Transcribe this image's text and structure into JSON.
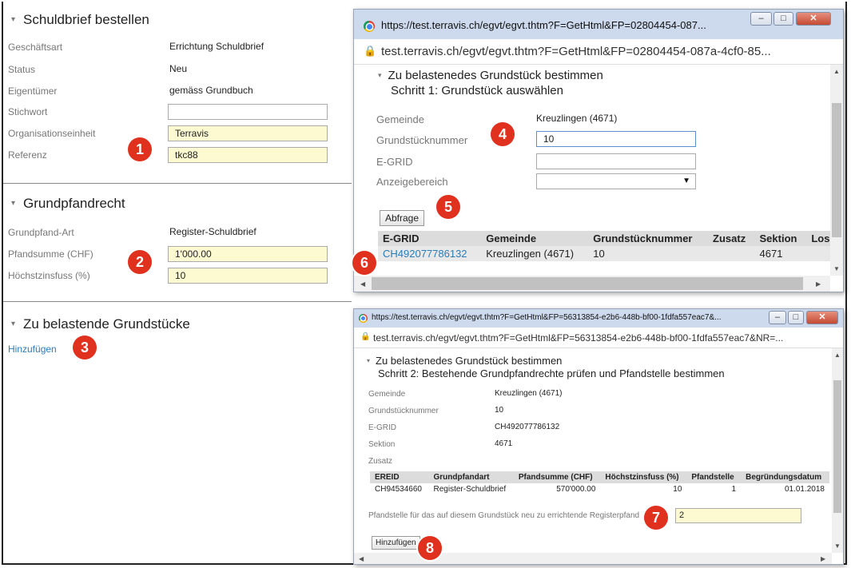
{
  "form": {
    "section1_title": "Schuldbrief bestellen",
    "fields1": [
      {
        "label": "Geschäftsart",
        "value": "Errichtung Schuldbrief"
      },
      {
        "label": "Status",
        "value": "Neu"
      },
      {
        "label": "Eigentümer",
        "value": "gemäss Grundbuch"
      }
    ],
    "stichwort_label": "Stichwort",
    "stichwort_value": "",
    "org_label": "Organisationseinheit",
    "org_value": "Terravis",
    "ref_label": "Referenz",
    "ref_value": "tkc88",
    "section2_title": "Grundpfandrecht",
    "art_label": "Grundpfand-Art",
    "art_value": "Register-Schuldbrief",
    "pfand_label": "Pfandsumme (CHF)",
    "pfand_value": "1'000.00",
    "zins_label": "Höchstzinsfuss (%)",
    "zins_value": "10",
    "section3_title": "Zu belastende Grundstücke",
    "add_link": "Hinzufügen"
  },
  "badges": [
    "1",
    "2",
    "3",
    "4",
    "5",
    "6",
    "7",
    "8"
  ],
  "window1": {
    "title": "https://test.terravis.ch/egvt/egvt.thtm?F=GetHtml&FP=02804454-087...",
    "url": "test.terravis.ch/egvt/egvt.thtm?F=GetHtml&FP=02804454-087a-4cf0-85...",
    "heading": "Zu belastenedes Grundstück bestimmen",
    "step": "Schritt 1: Grundstück auswählen",
    "gemeinde_label": "Gemeinde",
    "gemeinde_value": "Kreuzlingen (4671)",
    "nummer_label": "Grundstücknummer",
    "nummer_value": "10",
    "egrid_label": "E-GRID",
    "egrid_value": "",
    "anzeige_label": "Anzeigebereich",
    "anzeige_value": "",
    "query_button": "Abfrage",
    "table": {
      "headers": [
        "E-GRID",
        "Gemeinde",
        "Grundstücknummer",
        "Zusatz",
        "Sektion",
        "Los"
      ],
      "rows": [
        [
          "CH492077786132",
          "Kreuzlingen (4671)",
          "10",
          "",
          "4671",
          ""
        ]
      ]
    }
  },
  "window2": {
    "title": "https://test.terravis.ch/egvt/egvt.thtm?F=GetHtml&FP=56313854-e2b6-448b-bf00-1fdfa557eac7&...",
    "url": "test.terravis.ch/egvt/egvt.thtm?F=GetHtml&FP=56313854-e2b6-448b-bf00-1fdfa557eac7&NR=...",
    "heading": "Zu belastenedes Grundstück bestimmen",
    "step": "Schritt 2: Bestehende Grundpfandrechte prüfen und Pfandstelle bestimmen",
    "details": [
      {
        "label": "Gemeinde",
        "value": "Kreuzlingen (4671)"
      },
      {
        "label": "Grundstücknummer",
        "value": "10"
      },
      {
        "label": "E-GRID",
        "value": "CH492077786132"
      },
      {
        "label": "Sektion",
        "value": "4671"
      },
      {
        "label": "Zusatz",
        "value": ""
      }
    ],
    "table": {
      "headers": [
        "EREID",
        "Grundpfandart",
        "Pfandsumme (CHF)",
        "Höchstzinsfuss (%)",
        "Pfandstelle",
        "Begründungsdatum"
      ],
      "rows": [
        [
          "CH94534660",
          "Register-Schuldbrief",
          "570'000.00",
          "10",
          "1",
          "01.01.2018"
        ]
      ]
    },
    "pfandstelle_label": "Pfandstelle für das auf diesem Grundstück neu zu errichtende Registerpfand",
    "pfandstelle_value": "2",
    "add_button": "Hinzufügen"
  }
}
